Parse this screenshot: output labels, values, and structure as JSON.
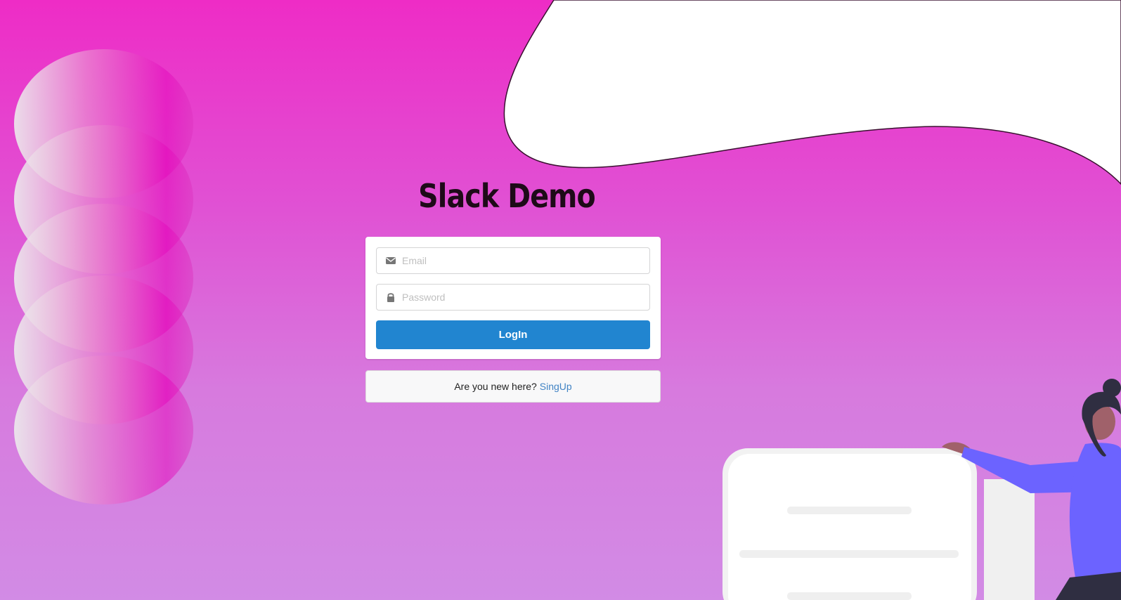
{
  "app": {
    "title": "Slack Demo"
  },
  "form": {
    "email_placeholder": "Email",
    "email_value": "",
    "password_placeholder": "Password",
    "password_value": "",
    "login_label": "LogIn"
  },
  "signup": {
    "prompt": "Are you new here?",
    "link_label": "SingUp"
  },
  "icons": {
    "email": "envelope-icon",
    "password": "lock-icon"
  },
  "colors": {
    "primary": "#2185d0",
    "link": "#4183c4",
    "background_top": "#ee2cc6",
    "background_bottom": "#d28be5"
  }
}
